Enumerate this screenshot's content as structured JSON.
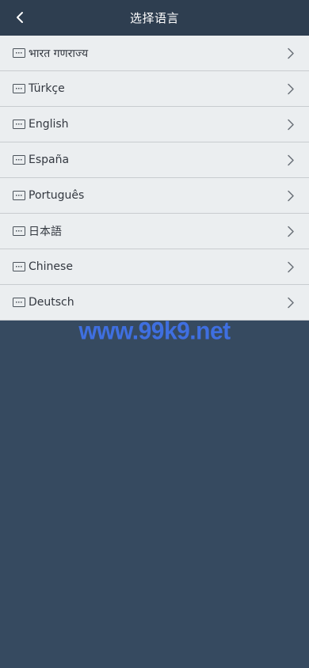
{
  "header": {
    "title": "选择语言",
    "back_icon": "chevron-left-icon"
  },
  "languages": [
    {
      "label": "भारत गणराज्य"
    },
    {
      "label": "Türkçe"
    },
    {
      "label": "English"
    },
    {
      "label": "España"
    },
    {
      "label": "Português"
    },
    {
      "label": "日本語"
    },
    {
      "label": "Chinese"
    },
    {
      "label": "Deutsch"
    }
  ],
  "item_icon": "keyboard-icon",
  "item_arrow_icon": "chevron-right-icon",
  "watermark": "www.99k9.net",
  "colors": {
    "header_bg": "#2e3e50",
    "page_bg": "#364a60",
    "list_bg": "#ebeef0",
    "watermark": "#3f6fe0"
  }
}
